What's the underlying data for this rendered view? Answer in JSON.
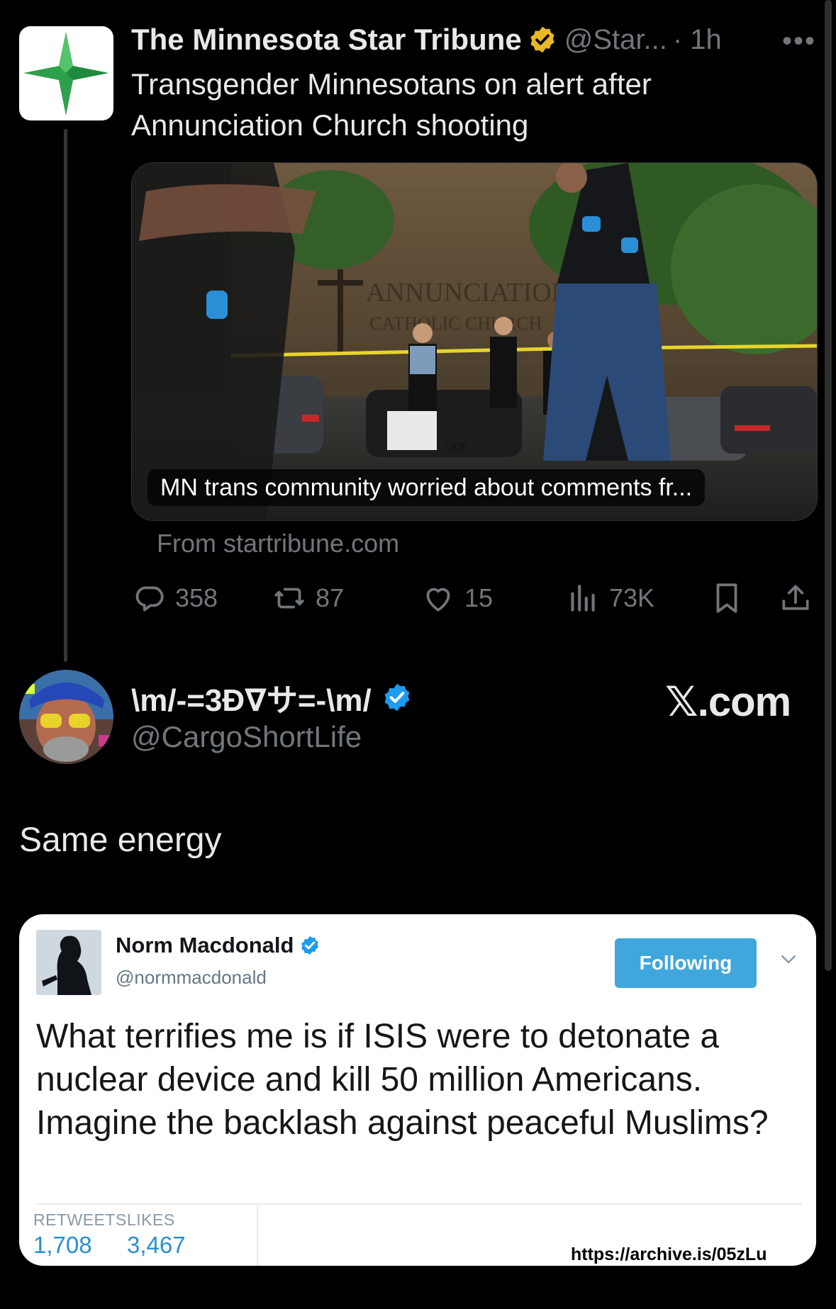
{
  "tweet": {
    "author_name": "The Minnesota Star Tribune",
    "author_handle": "@Star...",
    "time": "· 1h",
    "more": "•••",
    "text": "Transgender Minnesotans on alert after Annunciation Church shooting",
    "card": {
      "caption": "MN trans community worried about comments fr...",
      "sign_line1": "ANNUNCIATION",
      "sign_line2": "CATHOLIC CHURCH",
      "police_text": "LICE",
      "source": "From startribune.com"
    },
    "actions": {
      "replies": "358",
      "retweets": "87",
      "likes": "15",
      "views": "73K"
    },
    "icons": [
      "reply-icon",
      "retweet-icon",
      "like-icon",
      "views-icon",
      "bookmark-icon",
      "share-icon"
    ],
    "badge_color": "#e8b829"
  },
  "reply": {
    "author_name": "\\m/-=3Ð∇サ=-\\m/",
    "author_handle": "@CargoShortLife",
    "watermark": "𝕏.com",
    "text": "Same energy",
    "badge_color": "#1d9bf0"
  },
  "embedded_tweet": {
    "author_name": "Norm Macdonald",
    "author_handle": "@normmacdonald",
    "follow_label": "Following",
    "text": "What terrifies me is if ISIS were to detonate a nuclear device and kill 50 million Americans. Imagine the backlash against peaceful Muslims?",
    "retweets_label": "RETWEETS",
    "retweets": "1,708",
    "likes_label": "LIKES",
    "likes": "3,467",
    "archive_url": "https://archive.is/05zLu"
  }
}
